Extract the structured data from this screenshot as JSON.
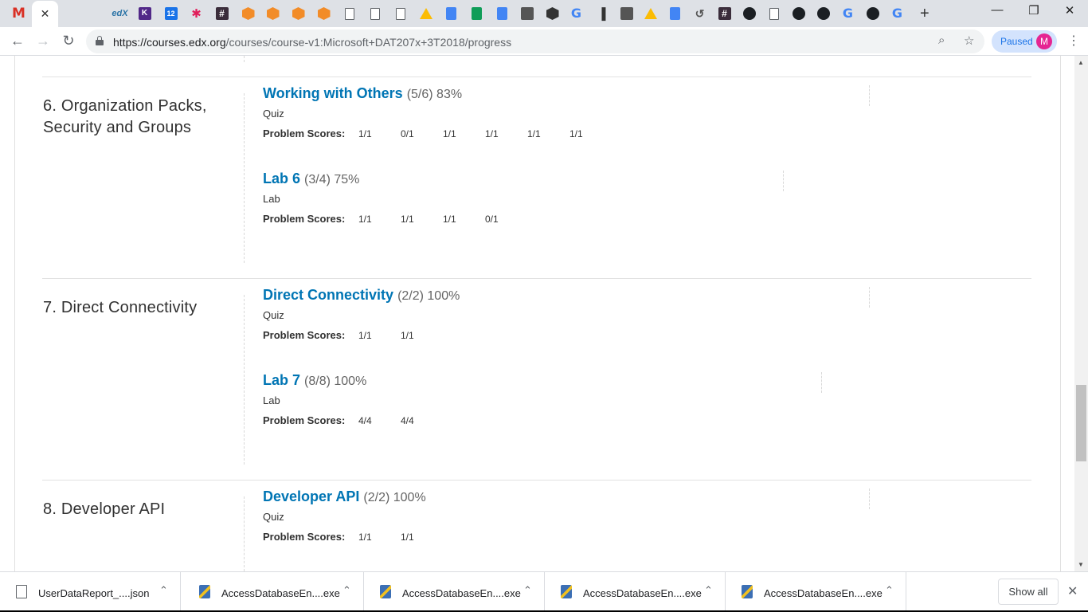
{
  "browser": {
    "tabs": [
      {
        "icon": "gmail-icon",
        "glyph": "M"
      },
      {
        "icon": "close-tab-icon",
        "glyph": "✕",
        "active": true
      },
      {
        "icon": "microsoft-icon",
        "glyph": ""
      },
      {
        "icon": "microsoft-icon",
        "glyph": ""
      },
      {
        "icon": "edx-icon",
        "glyph": "edX"
      },
      {
        "icon": "ksu-icon",
        "glyph": "K"
      },
      {
        "icon": "calendar-icon",
        "glyph": "12"
      },
      {
        "icon": "slack-icon",
        "glyph": "✱"
      },
      {
        "icon": "hashtag-icon",
        "glyph": "#"
      },
      {
        "icon": "box-icon",
        "glyph": ""
      },
      {
        "icon": "box-icon",
        "glyph": ""
      },
      {
        "icon": "box-icon",
        "glyph": ""
      },
      {
        "icon": "box-icon",
        "glyph": ""
      },
      {
        "icon": "document-icon",
        "glyph": ""
      },
      {
        "icon": "document-icon",
        "glyph": ""
      },
      {
        "icon": "document-icon",
        "glyph": ""
      },
      {
        "icon": "google-drive-icon",
        "glyph": ""
      },
      {
        "icon": "google-docs-icon",
        "glyph": ""
      },
      {
        "icon": "google-sheets-icon",
        "glyph": ""
      },
      {
        "icon": "google-docs-icon",
        "glyph": ""
      },
      {
        "icon": "app-icon",
        "glyph": ""
      },
      {
        "icon": "cube-icon",
        "glyph": ""
      },
      {
        "icon": "google-icon",
        "glyph": "G"
      },
      {
        "icon": "bar-chart-icon",
        "glyph": "▐"
      },
      {
        "icon": "app-icon",
        "glyph": ""
      },
      {
        "icon": "google-drive-icon",
        "glyph": ""
      },
      {
        "icon": "google-docs-icon",
        "glyph": ""
      },
      {
        "icon": "swirl-icon",
        "glyph": "↺"
      },
      {
        "icon": "hashtag-icon",
        "glyph": "#"
      },
      {
        "icon": "github-icon",
        "glyph": ""
      },
      {
        "icon": "document-icon",
        "glyph": ""
      },
      {
        "icon": "github-icon",
        "glyph": ""
      },
      {
        "icon": "github-icon",
        "glyph": ""
      },
      {
        "icon": "google-icon",
        "glyph": "G"
      },
      {
        "icon": "github-icon",
        "glyph": ""
      },
      {
        "icon": "google-icon",
        "glyph": "G"
      }
    ],
    "new_tab": "+",
    "window": {
      "minimize": "—",
      "restore": "❐",
      "close": "✕"
    },
    "nav": {
      "back": "←",
      "forward": "→",
      "reload": "↻"
    },
    "url_host": "https://courses.edx.org",
    "url_path": "/courses/course-v1:Microsoft+DAT207x+3T2018/progress",
    "zoom_icon": "⌕",
    "star_icon": "☆",
    "profile_status": "Paused",
    "profile_initial": "M",
    "menu": "⋮"
  },
  "progress": {
    "chapters": [
      {
        "title": "6. Organization Packs, Security and Groups",
        "sections": [
          {
            "name": "Working with Others",
            "score": "(5/6) 83%",
            "type": "Quiz",
            "label": "Problem Scores:",
            "scores": [
              "1/1",
              "0/1",
              "1/1",
              "1/1",
              "1/1",
              "1/1"
            ]
          },
          {
            "name": "Lab 6",
            "score": "(3/4) 75%",
            "type": "Lab",
            "label": "Problem Scores:",
            "scores": [
              "1/1",
              "1/1",
              "1/1",
              "0/1"
            ]
          }
        ]
      },
      {
        "title": "7. Direct Connectivity",
        "sections": [
          {
            "name": "Direct Connectivity",
            "score": "(2/2) 100%",
            "type": "Quiz",
            "label": "Problem Scores:",
            "scores": [
              "1/1",
              "1/1"
            ]
          },
          {
            "name": "Lab 7",
            "score": "(8/8) 100%",
            "type": "Lab",
            "label": "Problem Scores:",
            "scores": [
              "4/4",
              "4/4"
            ]
          }
        ]
      },
      {
        "title": "8. Developer API",
        "sections": [
          {
            "name": "Developer API",
            "score": "(2/2) 100%",
            "type": "Quiz",
            "label": "Problem Scores:",
            "scores": [
              "1/1",
              "1/1"
            ]
          }
        ]
      }
    ]
  },
  "downloads": {
    "items": [
      {
        "name": "UserDataReport_....json",
        "kind": "file"
      },
      {
        "name": "AccessDatabaseEn....exe",
        "kind": "exe"
      },
      {
        "name": "AccessDatabaseEn....exe",
        "kind": "exe"
      },
      {
        "name": "AccessDatabaseEn....exe",
        "kind": "exe"
      },
      {
        "name": "AccessDatabaseEn....exe",
        "kind": "exe"
      }
    ],
    "chevron": "⌃",
    "show_all": "Show all",
    "close": "✕"
  }
}
